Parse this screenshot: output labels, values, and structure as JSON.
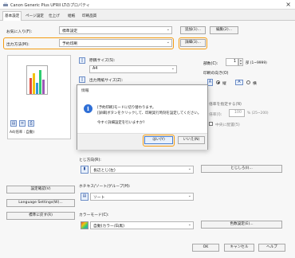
{
  "window": {
    "title": "Canon Generic Plus UFRII LTのプロパティ",
    "close_glyph": "×"
  },
  "tabs": [
    "基本設定",
    "ページ設定",
    "仕上げ",
    "給紙",
    "印刷品質"
  ],
  "favorites": {
    "label": "お気に入り(F):",
    "value": "標準設定",
    "add_button": "追加(1)...",
    "edit_button": "編集(2)..."
  },
  "output_method": {
    "label": "出力方法(M):",
    "value": "予約印刷",
    "details_button": "詳細(3)..."
  },
  "original_size": {
    "label": "原稿サイズ(S):",
    "value": "A4"
  },
  "output_size": {
    "label": "出力用紙サイズ(Z):"
  },
  "copies": {
    "label": "部数(C):",
    "value": "1",
    "unit": "部 (1~9999)"
  },
  "orientation": {
    "label": "印刷の向き(O)",
    "portrait": "縦",
    "landscape": "横",
    "selected": "portrait"
  },
  "manual_scaling": {
    "label": "倍率を指定する(N)",
    "label2": "倍率(I):",
    "value": "100",
    "range": "% (25~200)",
    "center_label": "中央に配置(5)"
  },
  "preview": {
    "caption": "A4(倍率 : 自動)"
  },
  "binding": {
    "label": "とじ方向(R):",
    "value": "長辺とじ(左)",
    "button": "とじしろ(I)..."
  },
  "staple": {
    "label": "ホチキス/ソート/グループ(H):",
    "value": "ソート"
  },
  "color_mode": {
    "label": "カラーモード(C):",
    "value": "自動(カラー/白黒)",
    "button": "色数設定(E)..."
  },
  "left_buttons": [
    "設定確認(V)",
    "Language Settings(W)...",
    "標準に戻す(R)"
  ],
  "footer_buttons": [
    "OK",
    "キャンセル",
    "ヘルプ"
  ],
  "dialog": {
    "title": "情報",
    "line1": "[予約印刷]モードに切り替わります。",
    "line2": "[詳細]ボタンをクリックして、印刷実行時刻を設定してください。",
    "line3": "今すぐ詳細設定を行いますか?",
    "yes": "はい(Y)",
    "no": "いいえ(N)"
  },
  "colors": {
    "accent": "#f39c12",
    "info": "#2f6fd6"
  }
}
